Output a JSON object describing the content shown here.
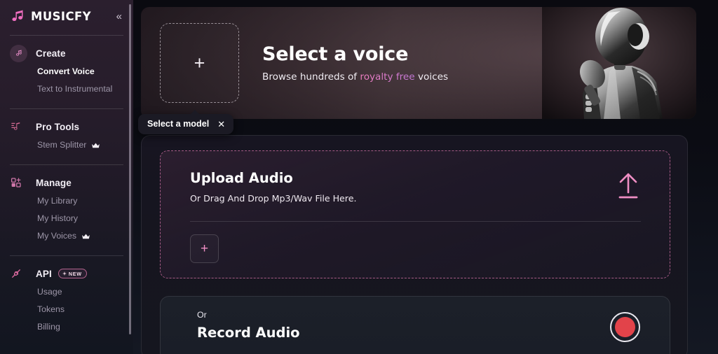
{
  "brand": {
    "name": "MUSICFY",
    "logo_icon": "music-note-icon",
    "collapse_icon": "«",
    "accent_pink": "#ef8ec4",
    "accent_purple": "#c278d8"
  },
  "sidebar": {
    "scrollbar": "sidebar-scrollbar",
    "groups": [
      {
        "icon": "music-note-circle-icon",
        "label": "Create",
        "items": [
          {
            "label": "Convert Voice",
            "active": true,
            "crown": false
          },
          {
            "label": "Text to Instrumental",
            "active": false,
            "crown": false
          }
        ]
      },
      {
        "icon": "pro-tools-icon",
        "label": "Pro Tools",
        "items": [
          {
            "label": "Stem Splitter",
            "active": false,
            "crown": true
          }
        ]
      },
      {
        "icon": "manage-grid-icon",
        "label": "Manage",
        "items": [
          {
            "label": "My Library",
            "active": false,
            "crown": false
          },
          {
            "label": "My History",
            "active": false,
            "crown": false
          },
          {
            "label": "My Voices",
            "active": false,
            "crown": true
          }
        ]
      },
      {
        "icon": "api-plug-icon",
        "label": "API",
        "badge": "NEW",
        "items": [
          {
            "label": "Usage",
            "active": false,
            "crown": false
          },
          {
            "label": "Tokens",
            "active": false,
            "crown": false
          },
          {
            "label": "Billing",
            "active": false,
            "crown": false
          }
        ]
      }
    ]
  },
  "hero": {
    "drop_plus": "+",
    "title": "Select a voice",
    "subtitle_before": "Browse hundreds of ",
    "subtitle_highlight": "royalty free",
    "subtitle_after": " voices",
    "image_alt": "robot-singer-image"
  },
  "tooltip": {
    "text": "Select a model",
    "close_icon": "✕"
  },
  "upload": {
    "title": "Upload Audio",
    "subtitle": "Or Drag And Drop Mp3/Wav File Here.",
    "add_plus": "+",
    "upload_icon": "upload-arrow-icon"
  },
  "record": {
    "or": "Or",
    "title": "Record Audio",
    "button_icon": "record-circle-icon"
  }
}
